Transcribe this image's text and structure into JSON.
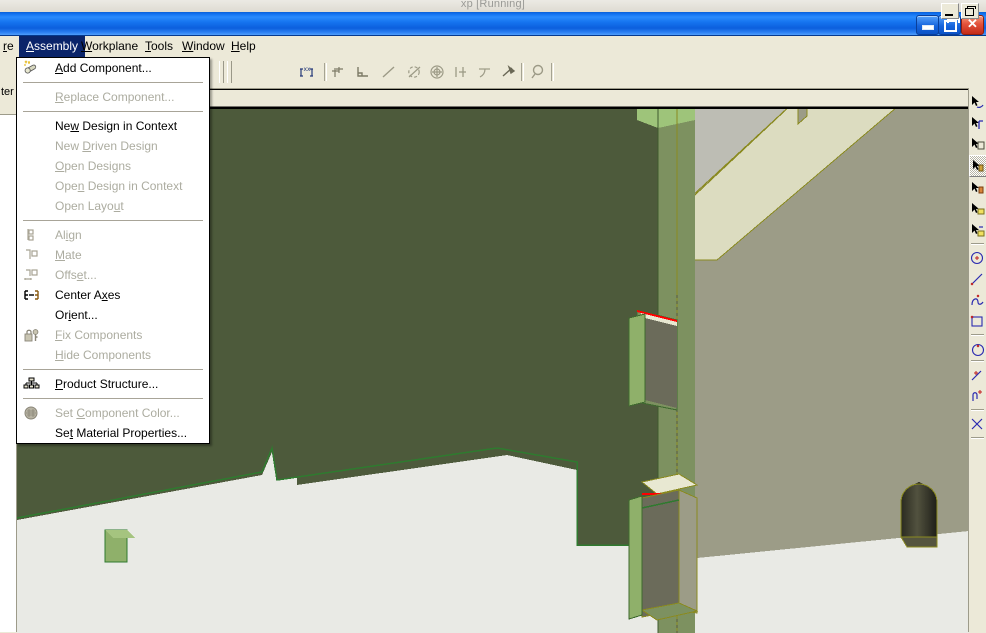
{
  "host": {
    "window_title": "xp [Running]"
  },
  "titlebar": {
    "minimize_label": "_",
    "maximize_label": "",
    "close_label": "✕"
  },
  "menubar": {
    "items": [
      {
        "label": "re",
        "selected": false
      },
      {
        "label": "Assembly",
        "selected": true
      },
      {
        "label": "Workplane",
        "selected": false
      },
      {
        "label": "Tools",
        "selected": false
      },
      {
        "label": "Window",
        "selected": false
      },
      {
        "label": "Help",
        "selected": false
      }
    ],
    "mdi_minimize": "minimize-icon",
    "mdi_restore": "restore-icon"
  },
  "toolbar": {
    "buttons": [
      {
        "name": "dimension-xx-icon",
        "tooltip": "Dimension"
      },
      {
        "name": "point-icon",
        "tooltip": "Point"
      },
      {
        "name": "corner-icon",
        "tooltip": "Corner"
      },
      {
        "name": "line-icon",
        "tooltip": "Line"
      },
      {
        "name": "angle-icon",
        "tooltip": "Angle"
      },
      {
        "name": "circle-center-icon",
        "tooltip": "Circle"
      },
      {
        "name": "parallel-icon",
        "tooltip": "Parallel"
      },
      {
        "name": "tangent-icon",
        "tooltip": "Tangent"
      },
      {
        "name": "fix-icon",
        "tooltip": "Fix"
      },
      {
        "name": "zoom-icon",
        "tooltip": "Zoom"
      }
    ]
  },
  "left_panel": {
    "label": "ter /"
  },
  "menu_popup": {
    "title": "Assembly",
    "items": [
      {
        "label": "Add Component...",
        "enabled": true,
        "icon": "add-component-icon",
        "mnemonic": "A",
        "separator_after": true
      },
      {
        "label": "Replace Component...",
        "enabled": false,
        "icon": "",
        "mnemonic": "R",
        "separator_after": true
      },
      {
        "label": "New Design in Context",
        "enabled": true,
        "icon": "",
        "mnemonic": "w",
        "separator_after": false
      },
      {
        "label": "New Driven Design",
        "enabled": false,
        "icon": "",
        "mnemonic": "D",
        "separator_after": false
      },
      {
        "label": "Open Designs",
        "enabled": false,
        "icon": "",
        "mnemonic": "O",
        "separator_after": false
      },
      {
        "label": "Open Design in Context",
        "enabled": false,
        "icon": "",
        "mnemonic": "n",
        "separator_after": false
      },
      {
        "label": "Open Layout",
        "enabled": false,
        "icon": "",
        "mnemonic": "u",
        "separator_after": true
      },
      {
        "label": "Align",
        "enabled": false,
        "icon": "align-icon",
        "mnemonic": "i",
        "separator_after": false
      },
      {
        "label": "Mate",
        "enabled": false,
        "icon": "mate-icon",
        "mnemonic": "M",
        "separator_after": false
      },
      {
        "label": "Offset...",
        "enabled": false,
        "icon": "offset-icon",
        "mnemonic": "e",
        "separator_after": false
      },
      {
        "label": "Center Axes",
        "enabled": true,
        "icon": "center-axes-icon",
        "mnemonic": "x",
        "separator_after": false
      },
      {
        "label": "Orient...",
        "enabled": true,
        "icon": "",
        "mnemonic": "i",
        "separator_after": false
      },
      {
        "label": "Fix Components",
        "enabled": false,
        "icon": "fix-components-icon",
        "mnemonic": "F",
        "separator_after": false
      },
      {
        "label": "Hide Components",
        "enabled": false,
        "icon": "",
        "mnemonic": "H",
        "separator_after": true
      },
      {
        "label": "Product Structure...",
        "enabled": true,
        "icon": "product-structure-icon",
        "mnemonic": "P",
        "separator_after": true
      },
      {
        "label": "Set Component Color...",
        "enabled": false,
        "icon": "set-component-color-icon",
        "mnemonic": "C",
        "separator_after": false
      },
      {
        "label": "Set Material Properties...",
        "enabled": true,
        "icon": "",
        "mnemonic": "t",
        "separator_after": false
      }
    ]
  },
  "right_toolbar": {
    "buttons": [
      {
        "name": "select-curve-icon",
        "active": false
      },
      {
        "name": "select-edge-icon",
        "active": false
      },
      {
        "name": "select-face-icon",
        "active": false
      },
      {
        "name": "select-body-icon",
        "active": true
      },
      {
        "name": "select-feature-icon",
        "active": false
      },
      {
        "name": "select-plane-icon",
        "active": false
      },
      {
        "name": "select-sketch-icon",
        "active": false
      },
      {
        "name": "circle-tool-icon",
        "active": false
      },
      {
        "name": "line-tool-icon",
        "active": false
      },
      {
        "name": "spline-tool-icon",
        "active": false
      },
      {
        "name": "rect-tool-icon",
        "active": false
      },
      {
        "name": "arc-tool-icon",
        "active": false
      },
      {
        "name": "point-tool-icon",
        "active": false
      },
      {
        "name": "trim-tool-icon",
        "active": false
      }
    ]
  },
  "viewport": {
    "name": "3d-model-viewport",
    "background_color": "#e9eae5",
    "colors": {
      "part_dark_green": "#4d5a3b",
      "part_mid_green": "#7d9160",
      "part_light_green": "#8fb06a",
      "part_grey": "#9c9c87",
      "part_light_grey": "#bdbdb4",
      "part_cream": "#dcdcc0",
      "edge_olive": "#8a8a20",
      "edge_red": "#ff0000",
      "edge_green": "#2f7a2f"
    }
  }
}
